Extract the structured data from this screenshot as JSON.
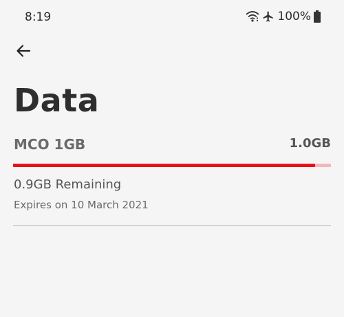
{
  "status_bar": {
    "time": "8:19",
    "battery_percent": "100%",
    "icons": [
      "wifi-icon",
      "airplane-mode-icon",
      "battery-icon"
    ]
  },
  "header": {
    "back_icon": "back-arrow-icon",
    "title": "Data"
  },
  "plan": {
    "name": "MCO 1GB",
    "total": "1.0GB",
    "remaining": "0.9GB Remaining",
    "expiry": "Expires on 10 March 2021",
    "remaining_fraction": 0.95
  },
  "colors": {
    "accent": "#e8101b",
    "track": "#f4b6bb",
    "background": "#f5f5f5"
  }
}
